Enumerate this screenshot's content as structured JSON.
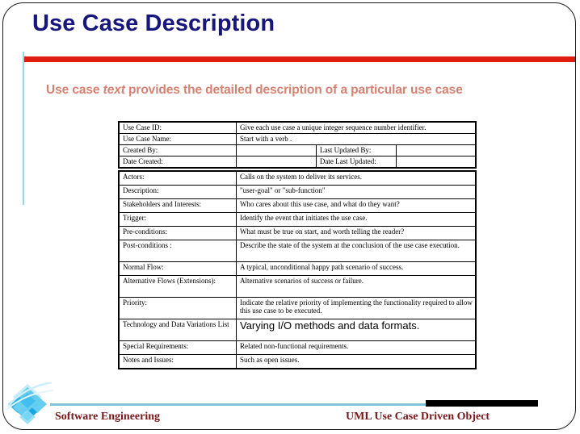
{
  "slide": {
    "title": "Use Case Description",
    "subtitle_before": "Use case ",
    "subtitle_italic": "text",
    "subtitle_after": " provides the detailed description of a particular use case",
    "accent_red": "#e01b10",
    "accent_cyan": "#8fdbe8",
    "title_color": "#16167e",
    "subtitle_color": "#d98070",
    "footer_color": "#7c1618"
  },
  "header_table": {
    "rows": [
      {
        "label": "Use Case ID:",
        "value": "Give each use case a unique integer sequence number identifier."
      },
      {
        "label": "Use Case Name:",
        "value": "Start with a verb ."
      },
      {
        "label": "Created By:",
        "value": "",
        "label2": "Last Updated By:",
        "value2": ""
      },
      {
        "label": "Date Created:",
        "value": "",
        "label2": "Date Last Updated:",
        "value2": ""
      }
    ]
  },
  "body_table": {
    "rows": [
      {
        "label": "Actors:",
        "value": "Calls on the system to deliver its services."
      },
      {
        "label": "Description:",
        "value": "\"user-goal\" or \"sub-function\""
      },
      {
        "label": "Stakeholders and Interests:",
        "value": "Who cares about this use case, and what do they want?"
      },
      {
        "label": "Trigger:",
        "value": "Identify the event that initiates the use case."
      },
      {
        "label": "Pre-conditions:",
        "value": "What must be true on start, and worth telling the reader?"
      },
      {
        "label": "Post-conditions :",
        "value": "Describe the state of the system at the conclusion of the use case execution."
      },
      {
        "label": "Normal Flow:",
        "value": "A typical, unconditional happy path scenario of success."
      },
      {
        "label": "Alternative Flows (Extensions):",
        "value": "Alternative scenarios of success or failure."
      },
      {
        "label": "Priority:",
        "value": "Indicate the relative priority of implementing the functionality required to allow this use case to be executed."
      },
      {
        "label": "Technology and Data Variations List",
        "value": "Varying I/O methods and data formats."
      },
      {
        "label": "Special Requirements:",
        "value": "Related non-functional requirements."
      },
      {
        "label": "Notes and Issues:",
        "value": "Such as open issues."
      }
    ]
  },
  "footer": {
    "left": "Software Engineering",
    "right": "UML Use Case Driven Object"
  }
}
